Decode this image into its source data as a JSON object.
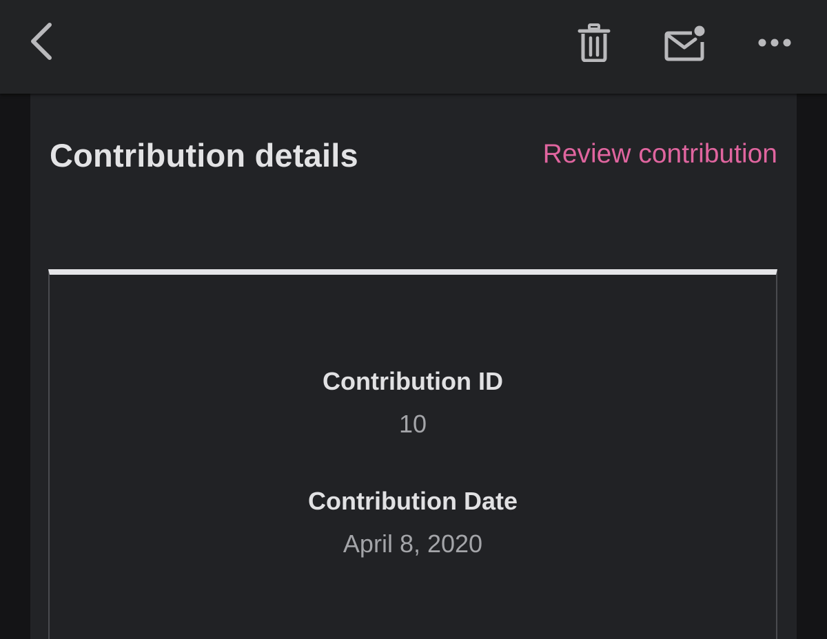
{
  "toolbar": {
    "back_icon": "chevron-left-icon",
    "delete_icon": "trash-icon",
    "unread_icon": "mail-unread-icon",
    "more_icon": "more-horizontal-icon"
  },
  "email": {
    "title": "Contribution details",
    "review_link": "Review contribution",
    "fields": [
      {
        "label": "Contribution ID",
        "value": "10"
      },
      {
        "label": "Contribution Date",
        "value": "April 8, 2020"
      }
    ]
  },
  "colors": {
    "toolbar_bg": "#222325",
    "card_bg": "#222326",
    "link": "#e0659f",
    "divider": "#e5e5e8"
  }
}
